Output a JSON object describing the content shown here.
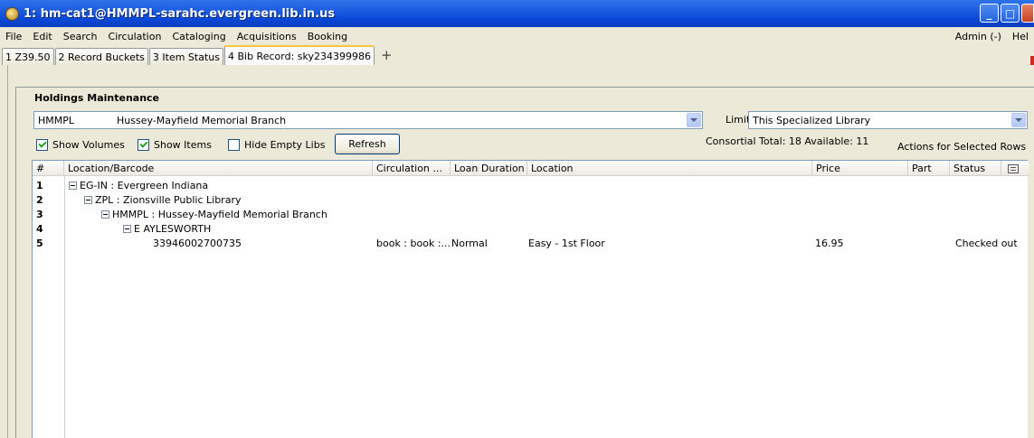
{
  "window": {
    "title": "1: hm-cat1@HMMPL-sarahc.evergreen.lib.in.us"
  },
  "menu": {
    "items": [
      "File",
      "Edit",
      "Search",
      "Circulation",
      "Cataloging",
      "Acquisitions",
      "Booking"
    ],
    "right": [
      "Admin (-)",
      "Hel"
    ]
  },
  "tabs": [
    {
      "label": "1 Z39.50"
    },
    {
      "label": "2 Record Buckets"
    },
    {
      "label": "3 Item Status"
    },
    {
      "label": "4 Bib Record: sky234399986",
      "active": true
    }
  ],
  "tab_add": "+",
  "holdings": {
    "title": "Holdings Maintenance",
    "library_code": "HMMPL",
    "library_name": "Hussey-Mayfield Memorial Branch",
    "limit_label": "Limit:",
    "limit_value": "This Specialized Library",
    "show_volumes": "Show Volumes",
    "show_items": "Show Items",
    "hide_empty": "Hide Empty Libs",
    "refresh": "Refresh",
    "totals": "Consortial Total:  18  Available:  11",
    "actions": "Actions for Selected Rows"
  },
  "table": {
    "columns": [
      "#",
      "Location/Barcode",
      "Circulation ...",
      "Loan Duration",
      "Location",
      "Price",
      "Part",
      "Status"
    ],
    "rows": [
      {
        "n": "1",
        "label": "EG-IN : Evergreen Indiana",
        "level": 0,
        "twisty": true
      },
      {
        "n": "2",
        "label": "ZPL : Zionsville Public Library",
        "level": 1,
        "twisty": true
      },
      {
        "n": "3",
        "label": "HMMPL : Hussey-Mayfield Memorial Branch",
        "level": 2,
        "twisty": true
      },
      {
        "n": "4",
        "label": "E AYLESWORTH",
        "level": 3,
        "twisty": true
      },
      {
        "n": "5",
        "label": "33946002700735",
        "level": 4,
        "twisty": false,
        "circ": "book : book :...",
        "loan": "Normal",
        "location": "Easy - 1st Floor",
        "price": "16.95",
        "part": "",
        "status": "Checked out"
      }
    ]
  }
}
